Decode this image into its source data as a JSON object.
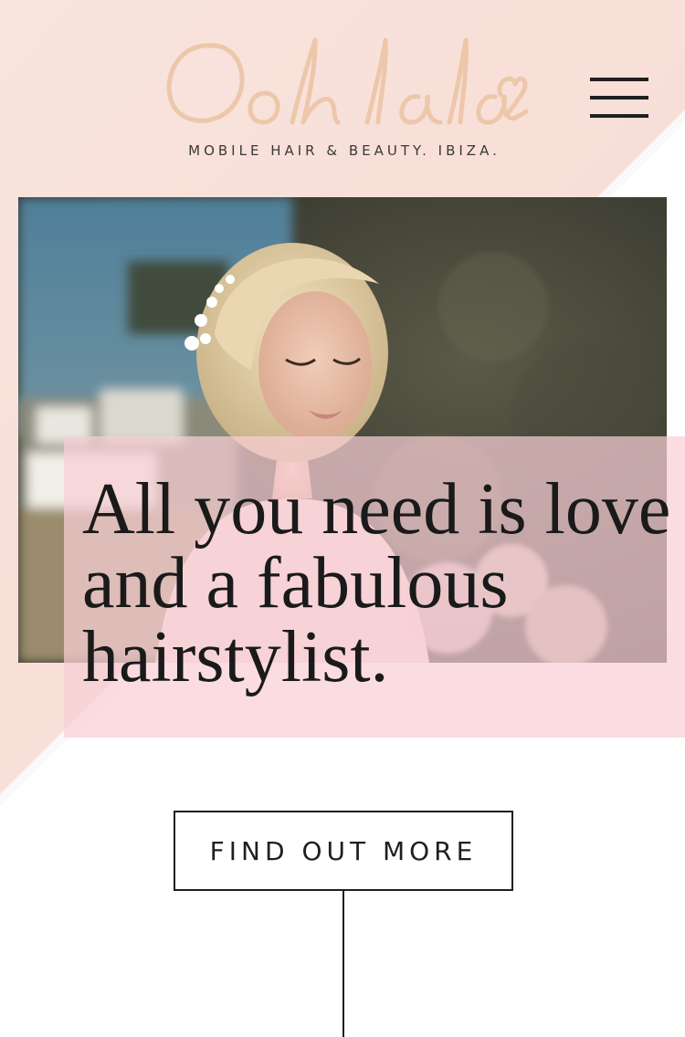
{
  "brand": {
    "logo_text": "Ooh lala",
    "tagline": "MOBILE HAIR & BEAUTY. IBIZA."
  },
  "hero": {
    "quote": "All you need is love and a fabulous hairstylist."
  },
  "cta": {
    "label": "FIND OUT MORE"
  },
  "icons": {
    "menu": "hamburger-menu-icon"
  },
  "colors": {
    "logo": "#edc7a9",
    "background_pink": "#f9e1dc",
    "quote_box": "#f8ced6",
    "text_dark": "#1a1a1a"
  }
}
